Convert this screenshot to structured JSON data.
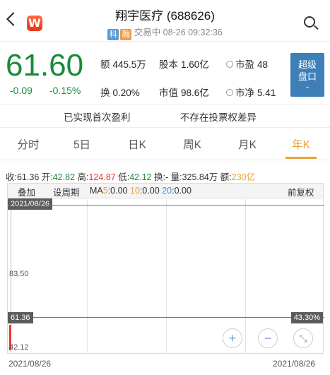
{
  "header": {
    "title": "翔宇医疗 (688626)",
    "tag1": "科",
    "tag2": "融",
    "status": "交易中 08-26 09:32:36",
    "logo": "W"
  },
  "quote": {
    "price": "61.60",
    "change": "-0.09",
    "change_pct": "-0.15%",
    "amount_label": "额",
    "amount_value": "445.5万",
    "shares_label": "股本",
    "shares_value": "1.60亿",
    "pe_label": "市盈",
    "pe_value": "48",
    "turnover_label": "换",
    "turnover_value": "0.20%",
    "mcap_label": "市值",
    "mcap_value": "98.6亿",
    "pb_label": "市净",
    "pb_value": "5.41",
    "super_button_line1": "超级",
    "super_button_line2": "盘口",
    "super_button_chev": "⌄"
  },
  "notes": {
    "profit": "已实现首次盈利",
    "voting": "不存在投票权差异"
  },
  "tabs": [
    "分时",
    "5日",
    "日K",
    "周K",
    "月K",
    "年K"
  ],
  "active_tab": "年K",
  "summary": {
    "close_label": "收:",
    "close": "61.36",
    "open_label": "开:",
    "open": "42.82",
    "high_label": "高:",
    "high": "124.87",
    "low_label": "低:",
    "low": "42.12",
    "chg_label": "换:",
    "chg": "-",
    "vol_label": "量:",
    "vol": "325.84万",
    "amt_label": "额:",
    "amt": "230亿"
  },
  "toolbar": {
    "overlay": "叠加",
    "period": "设周期",
    "ma_prefix": "MA",
    "ma5_label": "5",
    "ma5_value": ":0.00",
    "ma10_label": "10",
    "ma10_value": ":0.00",
    "ma20_label": "20",
    "ma20_value": ":0.00",
    "adjust": "前复权"
  },
  "chart": {
    "top_date": "2021/08/26",
    "mid_price": "83.50",
    "current_price": "61.36",
    "current_pct": "43.30%",
    "low_price": "42.12",
    "zoom_in": "+",
    "zoom_out": "−",
    "expand": "⤡",
    "start_date": "2021/08/26",
    "end_date": "2021/08/26"
  },
  "colors": {
    "down": "#1a8a3a",
    "up": "#e8392c",
    "accent": "#e8a33a",
    "button": "#3f7fb8"
  }
}
